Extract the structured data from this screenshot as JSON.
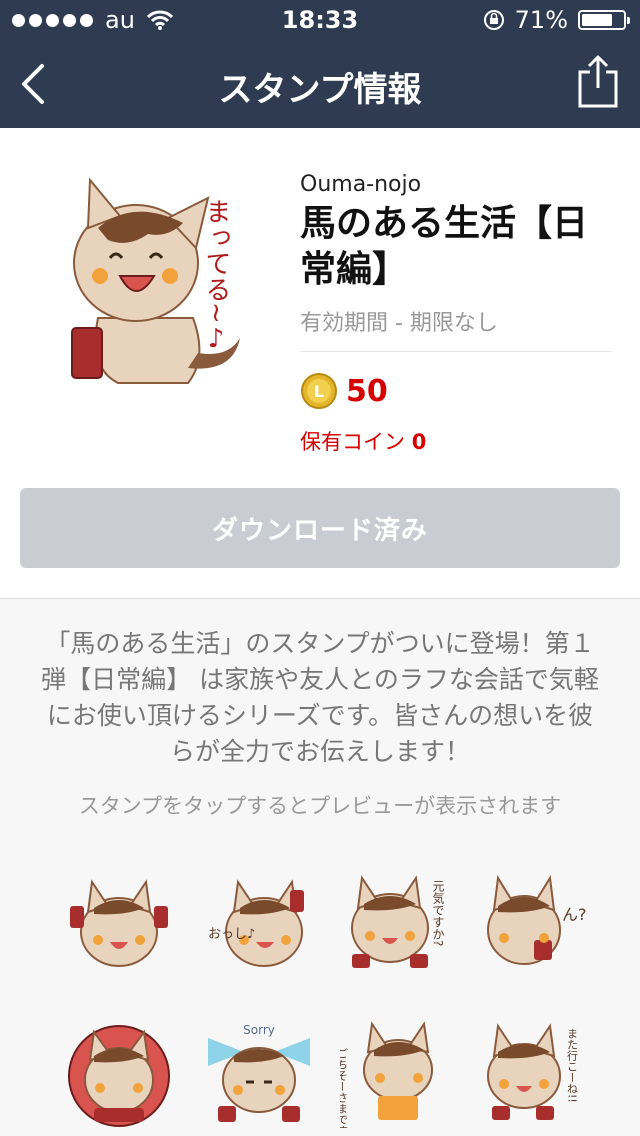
{
  "status_bar": {
    "carrier": "au",
    "time": "18:33",
    "battery": "71%"
  },
  "nav": {
    "title": "スタンプ情報"
  },
  "product": {
    "author": "Ouma-nojo",
    "title": "馬のある生活【日常編】",
    "validity": "有効期間 - 期限なし",
    "price": "50",
    "owned_label": "保有コイン",
    "owned_value": "0",
    "sticker_text": "まってる~♪"
  },
  "download": {
    "label": "ダウンロード済み"
  },
  "description": "「馬のある生活」のスタンプがついに登場！第１弾【日常編】 は家族や友人とのラフな会話で気軽にお使い頂けるシリーズです。皆さんの想いを彼らが全力でお伝えします！",
  "hint": "スタンプをタップするとプレビューが表示されます",
  "stickers": [
    {
      "text": ""
    },
    {
      "text": "おっし♪"
    },
    {
      "text": "元気ですか?"
    },
    {
      "text": "ん?"
    },
    {
      "text": ""
    },
    {
      "text": "Sorry"
    },
    {
      "text": "ごちそーさまです"
    },
    {
      "text": "また行こーね!!"
    }
  ],
  "colors": {
    "nav": "#2f3b50",
    "price": "#d60000",
    "button_disabled": "#c9ccd3"
  }
}
